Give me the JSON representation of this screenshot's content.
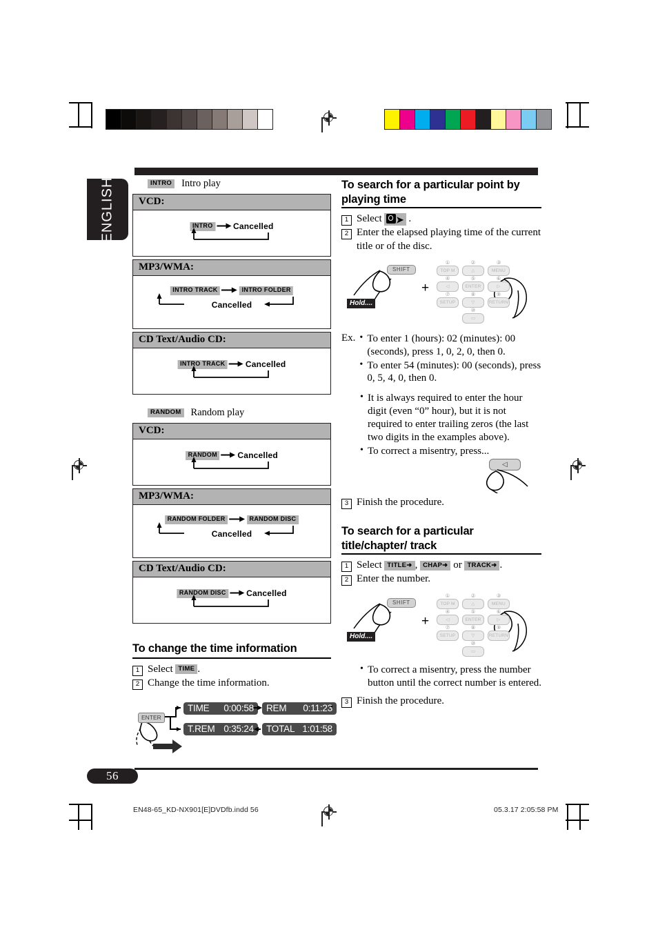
{
  "document": {
    "language_tab": "ENGLISH",
    "page_number": "56",
    "footer_filename": "EN48-65_KD-NX901[E]DVDfb.indd   56",
    "footer_date": "05.3.17   2:05:58 PM"
  },
  "printer_marks": {
    "grayscale_steps": [
      "#000000",
      "#0d0a0a",
      "#1a1614",
      "#262120",
      "#3b3432",
      "#4f4745",
      "#6b615e",
      "#857a76",
      "#a89e9a",
      "#cfc7c3",
      "#ffffff"
    ],
    "color_steps": [
      "#fff200",
      "#ec008c",
      "#00aeef",
      "#2e3192",
      "#00a651",
      "#ed1c24",
      "#231f20",
      "#fff79a",
      "#f795c5",
      "#7accf2",
      "#939598"
    ]
  },
  "left_column": {
    "intro": {
      "badge": "INTRO",
      "label": "Intro play",
      "tables": [
        {
          "header": "VCD:",
          "layout": "single",
          "nodes": [
            "INTRO"
          ],
          "cancelled": "Cancelled"
        },
        {
          "header": "MP3/WMA:",
          "layout": "double",
          "nodes": [
            "INTRO TRACK",
            "INTRO FOLDER"
          ],
          "cancelled": "Cancelled"
        },
        {
          "header": "CD Text/Audio CD:",
          "layout": "single",
          "nodes": [
            "INTRO TRACK"
          ],
          "cancelled": "Cancelled"
        }
      ]
    },
    "random": {
      "badge": "RANDOM",
      "label": "Random play",
      "tables": [
        {
          "header": "VCD:",
          "layout": "single",
          "nodes": [
            "RANDOM"
          ],
          "cancelled": "Cancelled"
        },
        {
          "header": "MP3/WMA:",
          "layout": "double",
          "nodes": [
            "RANDOM FOLDER",
            "RANDOM DISC"
          ],
          "cancelled": "Cancelled"
        },
        {
          "header": "CD Text/Audio CD:",
          "layout": "single",
          "nodes": [
            "RANDOM DISC"
          ],
          "cancelled": "Cancelled"
        }
      ]
    },
    "time_info": {
      "heading": "To change the time information",
      "step1_prefix": "Select",
      "step1_badge": "TIME",
      "step1_suffix": ".",
      "step2": "Change the time information.",
      "enter_button": "ENTER",
      "displays": [
        {
          "label": "TIME",
          "value": "0:00:58"
        },
        {
          "label": "REM",
          "value": "0:11:23"
        },
        {
          "label": "T.REM",
          "value": "0:35:24"
        },
        {
          "label": "TOTAL",
          "value": "1:01:58"
        }
      ]
    }
  },
  "right_column": {
    "search_time": {
      "heading": "To search for a particular point by playing time",
      "step1_prefix": "Select",
      "step1_icon": "clock-arrow-icon",
      "step1_suffix": ".",
      "step2": "Enter the elapsed playing time of the current title or of the disc.",
      "hold_label": "Hold....",
      "shift_label": "SHIFT",
      "plus": "+",
      "keypad": [
        {
          "num": "①",
          "label": "TOP M"
        },
        {
          "num": "②",
          "label": "△"
        },
        {
          "num": "③",
          "label": "MENU"
        },
        {
          "num": "④",
          "label": "◁"
        },
        {
          "num": "⑤",
          "label": "ENTER"
        },
        {
          "num": "⑥",
          "label": "▷"
        },
        {
          "num": "⑦",
          "label": "SETUP"
        },
        {
          "num": "⑧",
          "label": "▽"
        },
        {
          "num": "⑨",
          "label": "RETURN"
        },
        {
          "num": "⑩",
          "label": "▭"
        }
      ],
      "ex_label": "Ex.",
      "ex_bullets": [
        "To enter 1 (hours): 02 (minutes): 00 (seconds), press 1, 0, 2, 0, then 0.",
        "To enter 54 (minutes): 00 (seconds), press 0, 5, 4, 0, then 0."
      ],
      "notes": [
        "It is always required to enter the hour digit (even “0” hour), but it is not required to enter trailing zeros (the last two digits in the examples above).",
        "To correct a misentry, press..."
      ],
      "correct_key": "◁",
      "step3": "Finish the procedure."
    },
    "search_title": {
      "heading": "To search for a particular title/chapter/ track",
      "step1_prefix": "Select",
      "step1_badges": [
        "TITLE➜",
        "CHAP➜",
        "TRACK➜"
      ],
      "step1_sep1": ",",
      "step1_or": "or",
      "step1_suffix": ".",
      "step2": "Enter the number.",
      "hold_label": "Hold....",
      "shift_label": "SHIFT",
      "plus": "+",
      "keypad": [
        {
          "num": "①",
          "label": "TOP M"
        },
        {
          "num": "②",
          "label": "△"
        },
        {
          "num": "③",
          "label": "MENU"
        },
        {
          "num": "④",
          "label": "◁"
        },
        {
          "num": "⑤",
          "label": "ENTER"
        },
        {
          "num": "⑥",
          "label": "▷"
        },
        {
          "num": "⑦",
          "label": "SETUP"
        },
        {
          "num": "⑧",
          "label": "▽"
        },
        {
          "num": "⑨",
          "label": "RETURN"
        },
        {
          "num": "⑩",
          "label": "▭"
        }
      ],
      "note": "To correct a misentry, press the number button until the correct number is entered.",
      "step3": "Finish the procedure."
    }
  }
}
